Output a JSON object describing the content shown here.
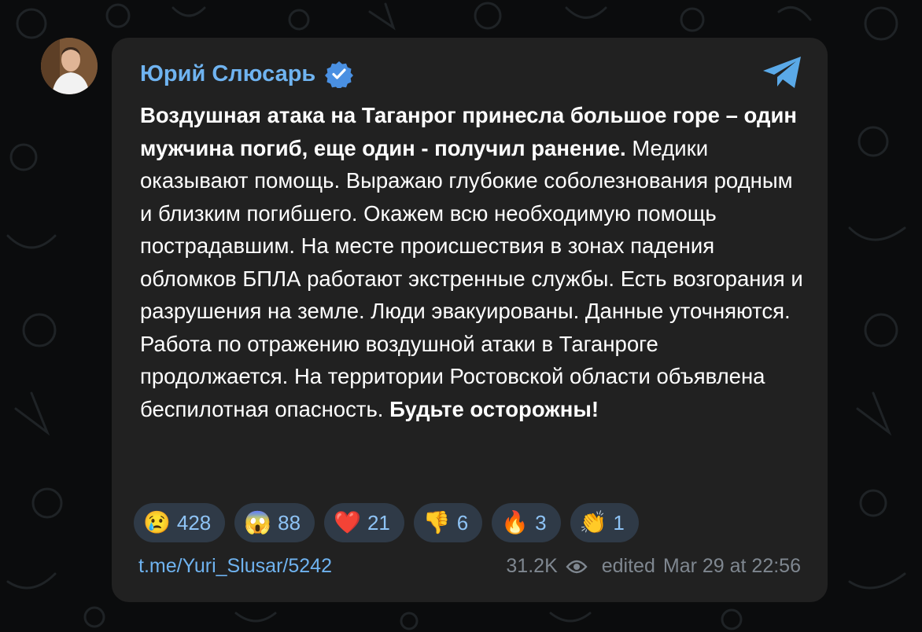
{
  "channel": {
    "author_name": "Юрий Слюсарь",
    "verified": true
  },
  "message": {
    "bold_intro": "Воздушная атака на Таганрог принесла большое горе – один мужчина погиб, еще один - получил ранение.",
    "body": " Медики оказывают помощь. Выражаю глубокие соболезнования родным и близким погибшего. Окажем всю необходимую помощь пострадавшим. На месте происшествия в зонах падения обломков БПЛА работают экстренные службы. Есть возгорания и разрушения на земле. Люди эвакуированы. Данные уточняются. Работа по отражению воздушной атаки в Таганроге продолжается. На территории Ростовской области объявлена беспилотная опасность. ",
    "bold_outro": "Будьте осторожны!"
  },
  "reactions": [
    {
      "emoji": "😢",
      "count": "428"
    },
    {
      "emoji": "😱",
      "count": "88"
    },
    {
      "emoji": "❤️",
      "count": "21"
    },
    {
      "emoji": "👎",
      "count": "6"
    },
    {
      "emoji": "🔥",
      "count": "3"
    },
    {
      "emoji": "👏",
      "count": "1"
    }
  ],
  "footer": {
    "link": "t.me/Yuri_Slusar/5242",
    "views": "31.2K",
    "edited_label": "edited",
    "timestamp": "Mar 29 at 22:56"
  },
  "icons": {
    "verified": "verified-badge-icon",
    "telegram": "telegram-logo-icon",
    "views": "eye-icon"
  },
  "colors": {
    "accent": "#6fb3f0",
    "bubble": "#212121",
    "reaction_bg": "#2f3a47",
    "verified_badge": "#4a90e2"
  }
}
